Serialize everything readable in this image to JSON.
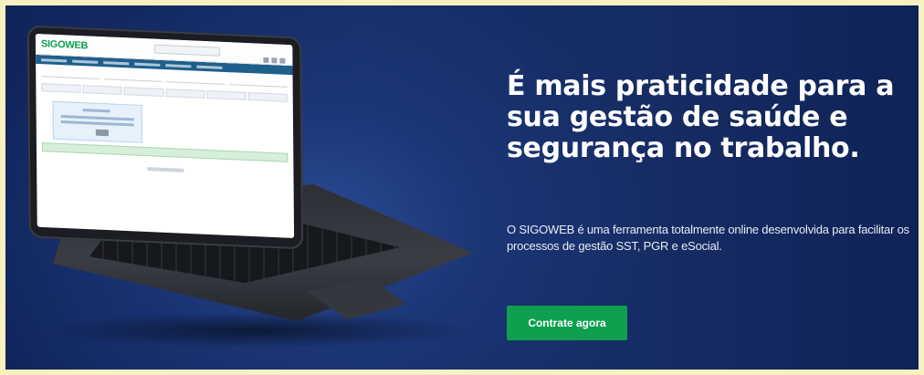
{
  "hero": {
    "headline": "É mais praticidade para a sua gestão de saúde e segurança no trabalho.",
    "description": "O SIGOWEB é uma ferramenta totalmente online desenvolvida para facilitar os processos de gestão SST, PGR e eSocial.",
    "cta_label": "Contrate agora"
  },
  "laptop_screen": {
    "logo_text": "SIGOWEB"
  },
  "colors": {
    "background": "#152c64",
    "cta": "#0e9f4f",
    "text": "#ffffff"
  }
}
